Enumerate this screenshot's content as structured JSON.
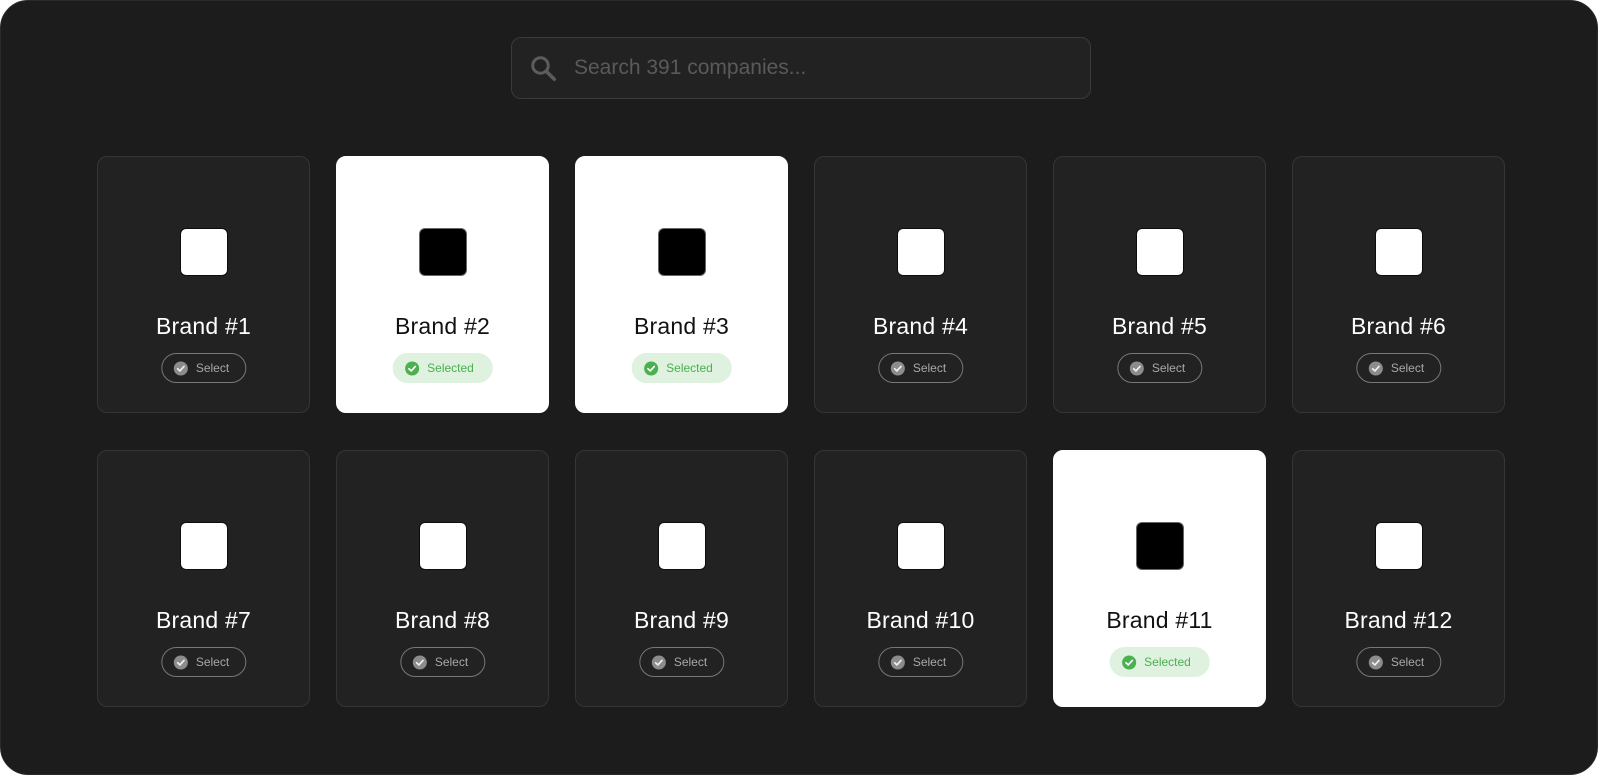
{
  "search": {
    "placeholder": "Search 391 companies..."
  },
  "colors": {
    "background": "#1b1c1b",
    "card": "#222222",
    "selected_card": "#ffffff",
    "selected_pill_bg": "#def2df",
    "selected_accent": "#4caf50"
  },
  "labels": {
    "select": "Select",
    "selected": "Selected"
  },
  "brands": [
    {
      "name": "Brand #1",
      "selected": false
    },
    {
      "name": "Brand #2",
      "selected": true
    },
    {
      "name": "Brand #3",
      "selected": true
    },
    {
      "name": "Brand #4",
      "selected": false
    },
    {
      "name": "Brand #5",
      "selected": false
    },
    {
      "name": "Brand #6",
      "selected": false
    },
    {
      "name": "Brand #7",
      "selected": false
    },
    {
      "name": "Brand #8",
      "selected": false
    },
    {
      "name": "Brand #9",
      "selected": false
    },
    {
      "name": "Brand #10",
      "selected": false
    },
    {
      "name": "Brand #11",
      "selected": true
    },
    {
      "name": "Brand #12",
      "selected": false
    }
  ],
  "icons": {
    "search": "search-icon",
    "check": "check-circle-icon",
    "logo": "brand-logo"
  }
}
